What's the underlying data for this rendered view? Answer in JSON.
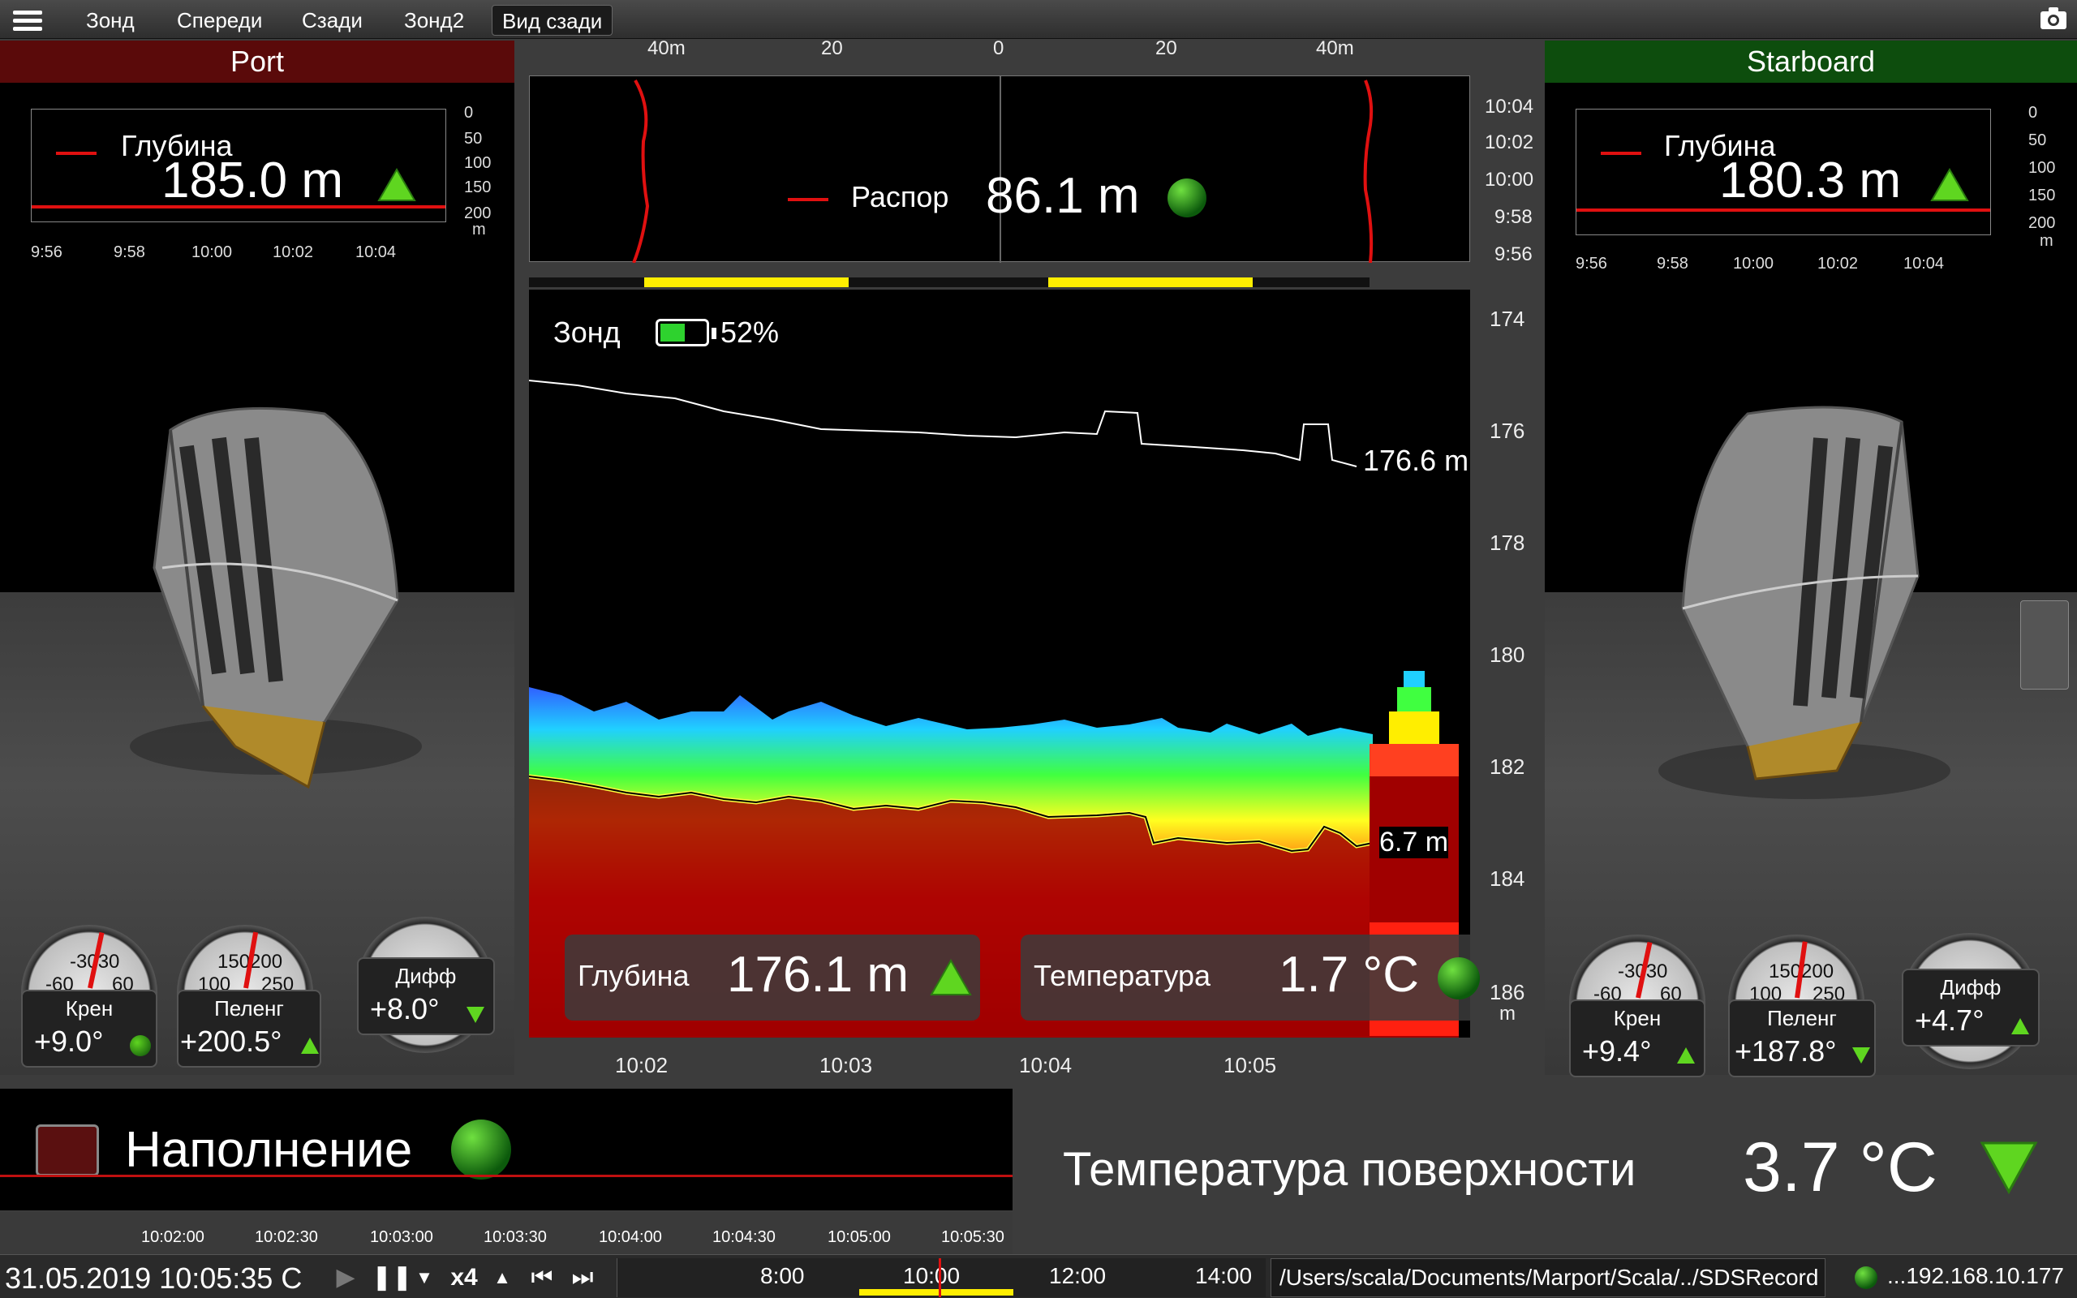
{
  "tabs": [
    {
      "label": "Зонд"
    },
    {
      "label": "Спереди"
    },
    {
      "label": "Сзади"
    },
    {
      "label": "Зонд2"
    },
    {
      "label": "Вид сзади"
    }
  ],
  "port": {
    "title": "Port",
    "depth_label": "Глубина",
    "depth_value": "185.0 m",
    "y_ticks": [
      "0",
      "50",
      "100",
      "150",
      "200",
      "m"
    ],
    "x_ticks": [
      "9:56",
      "9:58",
      "10:00",
      "10:02",
      "10:04"
    ],
    "roll": {
      "label": "Крен",
      "value": "+9.0°",
      "scale_left": "-60",
      "scale_mid": "-3030",
      "scale_right": "60"
    },
    "heading": {
      "label": "Пеленг",
      "value": "+200.5°",
      "scale_left": "100",
      "scale_mid": "150200",
      "scale_right": "250"
    },
    "diff": {
      "label": "Дифф",
      "value": "+8.0°"
    }
  },
  "starboard": {
    "title": "Starboard",
    "depth_label": "Глубина",
    "depth_value": "180.3 m",
    "y_ticks": [
      "0",
      "50",
      "100",
      "150",
      "200",
      "m"
    ],
    "x_ticks": [
      "9:56",
      "9:58",
      "10:00",
      "10:02",
      "10:04"
    ],
    "roll": {
      "label": "Крен",
      "value": "+9.4°",
      "scale_left": "-60",
      "scale_mid": "-3030",
      "scale_right": "60"
    },
    "heading": {
      "label": "Пеленг",
      "value": "+187.8°",
      "scale_left": "100",
      "scale_mid": "150200",
      "scale_right": "250"
    },
    "diff": {
      "label": "Дифф",
      "value": "+4.7°"
    }
  },
  "spread": {
    "label": "Распор",
    "value": "86.1 m",
    "top_ticks": [
      "40m",
      "20",
      "0",
      "20",
      "40m"
    ],
    "right_ticks": [
      "10:04",
      "10:02",
      "10:00",
      "9:58",
      "9:56"
    ]
  },
  "sonar": {
    "title": "Зонд",
    "battery": "52%",
    "top_marker": "176.6 m",
    "bottom_marker": "6.7 m",
    "depth_ticks": [
      "174",
      "176",
      "178",
      "180",
      "182",
      "184",
      "186",
      "m"
    ],
    "time_ticks": [
      "10:02",
      "10:03",
      "10:04",
      "10:05"
    ],
    "depth_label": "Глубина",
    "depth_value": "176.1 m",
    "temp_label": "Температура",
    "temp_value": "1.7 °C"
  },
  "fill": {
    "label": "Наполнение"
  },
  "surface_temp": {
    "label": "Температура поверхности",
    "value": "3.7 °C"
  },
  "timeline": {
    "ticks": [
      "10:02:00",
      "10:02:30",
      "10:03:00",
      "10:03:30",
      "10:04:00",
      "10:04:30",
      "10:05:00",
      "10:05:30"
    ]
  },
  "statusbar": {
    "datetime": "31.05.2019 10:05:35 C",
    "speed": "x4",
    "hours": [
      "8:00",
      "10:00",
      "12:00",
      "14:00"
    ],
    "path": "/Users/scala/Documents/Marport/Scala/../SDSRecord",
    "ip": "...192.168.10.177"
  },
  "colors": {
    "port_header": "#5a0a0a",
    "starboard_header": "#0d4d0d",
    "accent_yellow": "#ffee00",
    "trend_red": "#e01010"
  }
}
